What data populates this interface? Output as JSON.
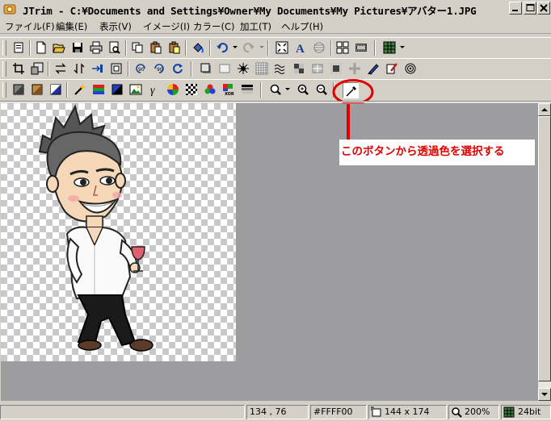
{
  "window": {
    "title": "JTrim - C:¥Documents and Settings¥Owner¥My Documents¥My Pictures¥アバター1.JPG"
  },
  "menu": [
    {
      "label": "ファイル(F)"
    },
    {
      "label": "編集(E)"
    },
    {
      "label": "表示(V)"
    },
    {
      "label": "イメージ(I)"
    },
    {
      "label": "カラー(C)"
    },
    {
      "label": "加工(T)"
    },
    {
      "label": "ヘルプ(H)"
    }
  ],
  "annotation": {
    "text": "このボタンから透過色を選択する",
    "color": "#e00000"
  },
  "status": {
    "coords": "134 , 76",
    "color_code": "#FFFF00",
    "image_size": "144 x 174",
    "zoom": "200%",
    "bit_depth": "24bit"
  },
  "colors": {
    "face": "#d4d0c8",
    "workspace": "#9d9d9f",
    "highlight": "#e00000"
  }
}
